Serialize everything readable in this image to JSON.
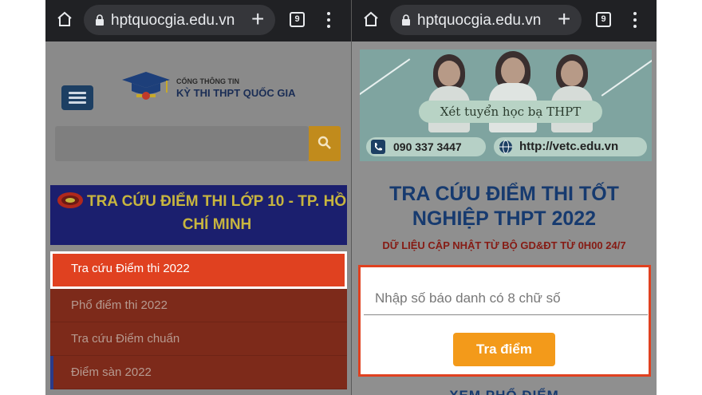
{
  "left": {
    "browser": {
      "url": "hptquocgia.edu.vn",
      "tab_count": "9",
      "icons": [
        "home-icon",
        "lock-icon",
        "plus-icon",
        "tabs-icon",
        "menu-dots-icon"
      ]
    },
    "site": {
      "logo_small": "CỔNG THÔNG TIN",
      "logo_big": "KỲ THI THPT QUỐC GIA",
      "search_placeholder": ""
    },
    "banner": {
      "line1": "TRA CỨU ĐIỂM THI LỚP 10 - TP. HỒ",
      "line2": "CHÍ MINH"
    },
    "menu": [
      {
        "label": "Tra cứu Điểm thi 2022",
        "active": true
      },
      {
        "label": "Phổ điểm thi 2022",
        "active": false
      },
      {
        "label": "Tra cứu Điểm chuẩn",
        "active": false
      },
      {
        "label": "Điểm sàn 2022",
        "active": false
      }
    ]
  },
  "right": {
    "browser": {
      "url": "hptquocgia.edu.vn",
      "tab_count": "9"
    },
    "ad": {
      "title": "Xét tuyển học bạ THPT",
      "phone": "090 337 3447",
      "website": "http://vetc.edu.vn"
    },
    "heading_line1": "TRA CỨU ĐIỂM THI TỐT",
    "heading_line2": "NGHIỆP THPT 2022",
    "subheading": "DỮ LIỆU CẬP NHẬT TỪ BỘ GD&ĐT TỪ 0H00 24/7",
    "form": {
      "placeholder": "Nhập số báo danh có 8 chữ số",
      "button": "Tra điểm"
    },
    "more": "XEM PHỔ ĐIỂM"
  },
  "colors": {
    "accent_orange": "#e04120",
    "button_orange": "#f39a1a",
    "navy": "#163a6f",
    "banner_gold": "#c7b53f"
  }
}
